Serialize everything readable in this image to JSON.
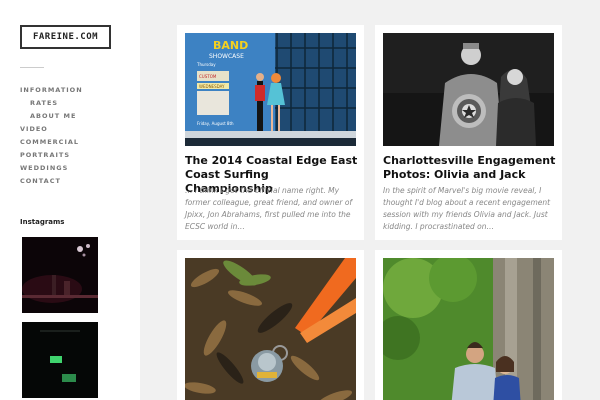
{
  "site": {
    "logo": "FAREINE.COM"
  },
  "nav": {
    "items": [
      {
        "label": "INFORMATION"
      },
      {
        "label": "RATES"
      },
      {
        "label": "ABOUT ME"
      },
      {
        "label": "VIDEO"
      },
      {
        "label": "COMMERCIAL"
      },
      {
        "label": "PORTRAITS"
      },
      {
        "label": "WEDDINGS"
      },
      {
        "label": "CONTACT"
      }
    ]
  },
  "instagram": {
    "title": "Instagrams"
  },
  "posts": [
    {
      "title": "The 2014 Coastal Edge East Coast Surfing Championship",
      "excerpt": "… I think I got the official name right. My former colleague, great friend, and owner of Jpixx, Jon Abrahams, first pulled me into the ECSC world in…",
      "image_signs": [
        "BAND",
        "SHOWCASE",
        "Thursday",
        "CUSTOM",
        "WEDNESDAY",
        "Friday, August 8th"
      ]
    },
    {
      "title": "Charlottesville Engagement Photos: Olivia and Jack",
      "excerpt": "In the spirit of Marvel's big movie reveal, I thought I'd blog about a recent engagement session with my friends Olivia and Jack. Just kidding. I procrastinated on…"
    },
    {
      "title": ""
    },
    {
      "title": ""
    }
  ],
  "colors": {
    "page_bg": "#f1f1f1",
    "card_bg": "#ffffff",
    "text_dark": "#111111",
    "text_muted": "#888888"
  }
}
